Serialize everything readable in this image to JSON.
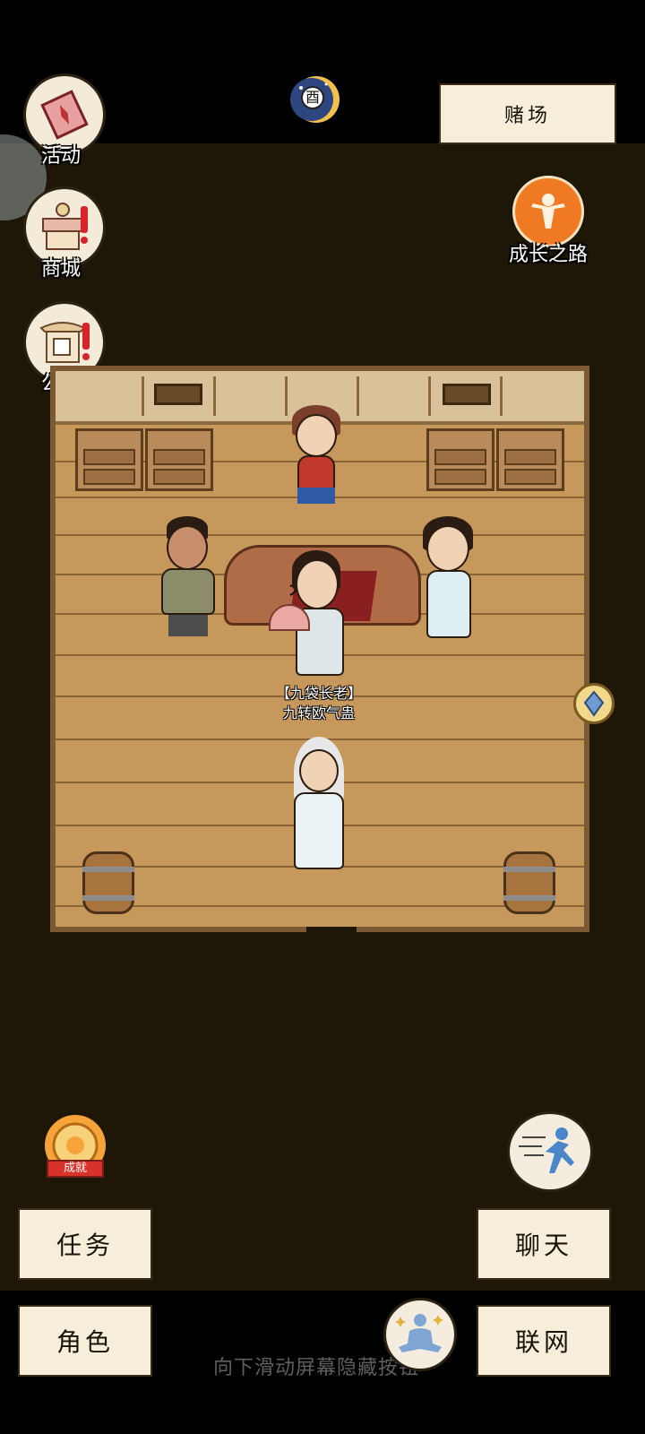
{
  "top_left_menu": {
    "activity": {
      "label": "活动",
      "icon": "banner-icon"
    },
    "shop": {
      "label": "商城",
      "icon": "shop-stall-icon"
    },
    "notice": {
      "label": "公告",
      "icon": "notice-board-icon"
    }
  },
  "top_center": {
    "icon": "moon-time-icon",
    "glyph": "酉"
  },
  "location_button": {
    "label": "赌场"
  },
  "growth_path": {
    "label": "成长之路",
    "icon": "growth-figure-icon"
  },
  "scene": {
    "npc_title": "【九袋长老】",
    "npc_name": "九转欧气蛊",
    "table_glyphs": "大  小"
  },
  "achievement": {
    "label": "成就",
    "icon": "medal-icon"
  },
  "run_button": {
    "icon": "running-man-icon"
  },
  "meditate_button": {
    "icon": "meditation-icon"
  },
  "bottom_buttons": {
    "tasks": "任务",
    "role": "角色",
    "chat": "聊天",
    "online": "联网"
  },
  "hint": "向下滑动屏幕隐藏按钮"
}
